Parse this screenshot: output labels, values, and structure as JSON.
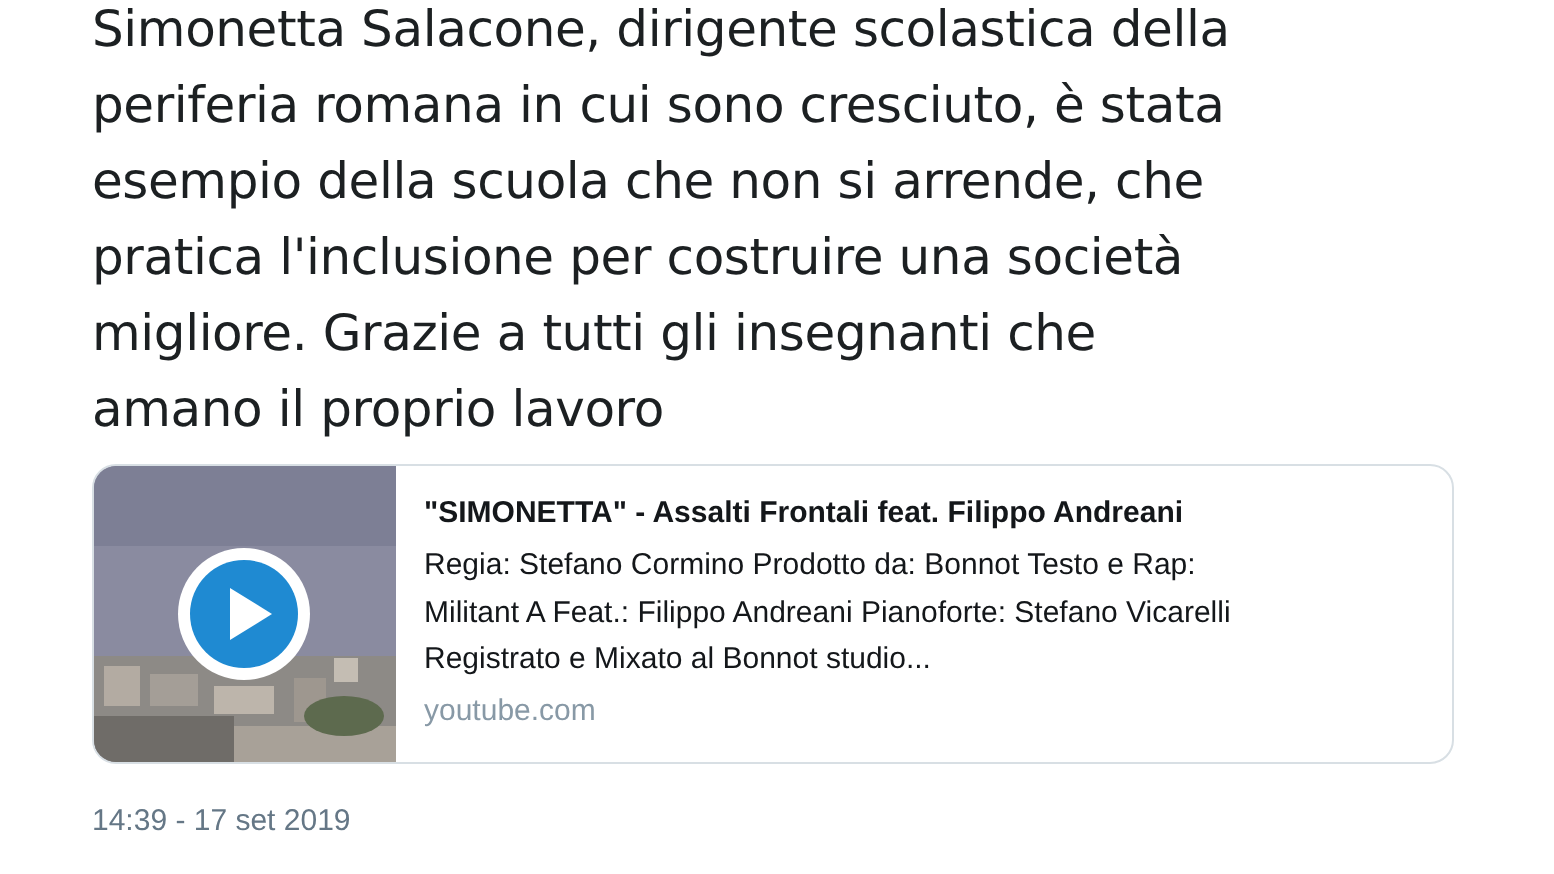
{
  "tweet": {
    "text_lines": [
      "Simonetta Salacone, dirigente scolastica della",
      "periferia romana in cui sono cresciuto, è stata",
      "esempio della scuola che non si arrende, che",
      "pratica l'inclusione per costruire una società",
      "migliore. Grazie a tutti gli insegnanti che",
      "amano il proprio lavoro"
    ],
    "link_card": {
      "title": "\"SIMONETTA\" - Assalti Frontali feat. Filippo Andreani",
      "description_lines": [
        "Regia: Stefano Cormino Prodotto da: Bonnot Testo e Rap:",
        "Militant A Feat.: Filippo Andreani Pianoforte: Stefano Vicarelli",
        "Registrato e Mixato al Bonnot studio..."
      ],
      "domain": "youtube.com"
    },
    "timestamp": "14:39 - 17 set 2019"
  }
}
